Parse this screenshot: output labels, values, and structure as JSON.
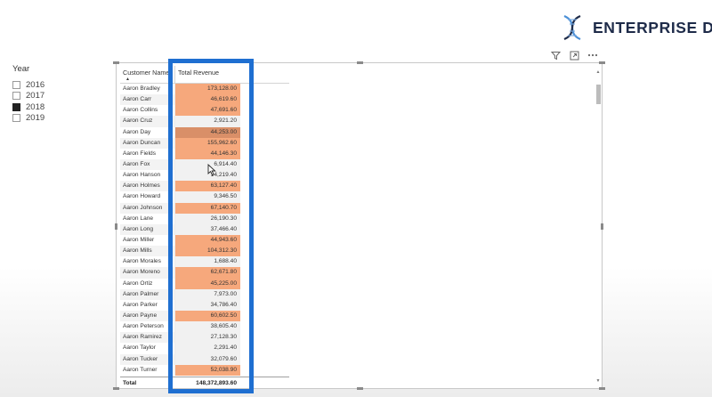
{
  "brand": {
    "name": "ENTERPRISE DNA",
    "color": "#1e2b49",
    "accent": "#4a8fd6"
  },
  "slicer": {
    "title": "Year",
    "items": [
      {
        "label": "2016",
        "checked": false
      },
      {
        "label": "2017",
        "checked": false
      },
      {
        "label": "2018",
        "checked": true
      },
      {
        "label": "2019",
        "checked": false
      }
    ]
  },
  "visual_header_icons": [
    "filter-icon",
    "focus-mode-icon",
    "more-options-icon"
  ],
  "table": {
    "columns": [
      "Customer Name",
      "Total Revenue"
    ],
    "sort_column": "Customer Name",
    "rows": [
      {
        "name": "Aaron Bradley",
        "revenue": "173,128.00",
        "shade": 1
      },
      {
        "name": "Aaron Carr",
        "revenue": "46,619.60",
        "shade": 1
      },
      {
        "name": "Aaron Collins",
        "revenue": "47,691.60",
        "shade": 1
      },
      {
        "name": "Aaron Cruz",
        "revenue": "2,921.20",
        "shade": 0
      },
      {
        "name": "Aaron Day",
        "revenue": "44,253.00",
        "shade": 2
      },
      {
        "name": "Aaron Duncan",
        "revenue": "155,962.60",
        "shade": 1
      },
      {
        "name": "Aaron Fields",
        "revenue": "44,146.30",
        "shade": 1
      },
      {
        "name": "Aaron Fox",
        "revenue": "6,914.40",
        "shade": 0
      },
      {
        "name": "Aaron Hanson",
        "revenue": "14,219.40",
        "shade": 0
      },
      {
        "name": "Aaron Holmes",
        "revenue": "63,127.40",
        "shade": 1
      },
      {
        "name": "Aaron Howard",
        "revenue": "9,346.50",
        "shade": 0
      },
      {
        "name": "Aaron Johnson",
        "revenue": "67,140.70",
        "shade": 1
      },
      {
        "name": "Aaron Lane",
        "revenue": "26,190.30",
        "shade": 0
      },
      {
        "name": "Aaron Long",
        "revenue": "37,466.40",
        "shade": 0
      },
      {
        "name": "Aaron Miller",
        "revenue": "44,943.60",
        "shade": 1
      },
      {
        "name": "Aaron Mills",
        "revenue": "104,312.30",
        "shade": 1
      },
      {
        "name": "Aaron Morales",
        "revenue": "1,688.40",
        "shade": 0
      },
      {
        "name": "Aaron Moreno",
        "revenue": "62,671.80",
        "shade": 1
      },
      {
        "name": "Aaron Ortiz",
        "revenue": "45,225.00",
        "shade": 1
      },
      {
        "name": "Aaron Palmer",
        "revenue": "7,973.00",
        "shade": 0
      },
      {
        "name": "Aaron Parker",
        "revenue": "34,786.40",
        "shade": 0
      },
      {
        "name": "Aaron Payne",
        "revenue": "60,602.50",
        "shade": 1
      },
      {
        "name": "Aaron Peterson",
        "revenue": "38,605.40",
        "shade": 0
      },
      {
        "name": "Aaron Ramirez",
        "revenue": "27,128.30",
        "shade": 0
      },
      {
        "name": "Aaron Taylor",
        "revenue": "2,291.40",
        "shade": 0
      },
      {
        "name": "Aaron Tucker",
        "revenue": "32,079.60",
        "shade": 0
      },
      {
        "name": "Aaron Turner",
        "revenue": "52,038.90",
        "shade": 1
      }
    ],
    "total_label": "Total",
    "total_value": "148,372,893.60",
    "conditional_colors": {
      "none": "#f1f1f1",
      "light": "#f6a87c",
      "dark": "#d98f68"
    }
  },
  "highlight_color": "#1f6fd1"
}
